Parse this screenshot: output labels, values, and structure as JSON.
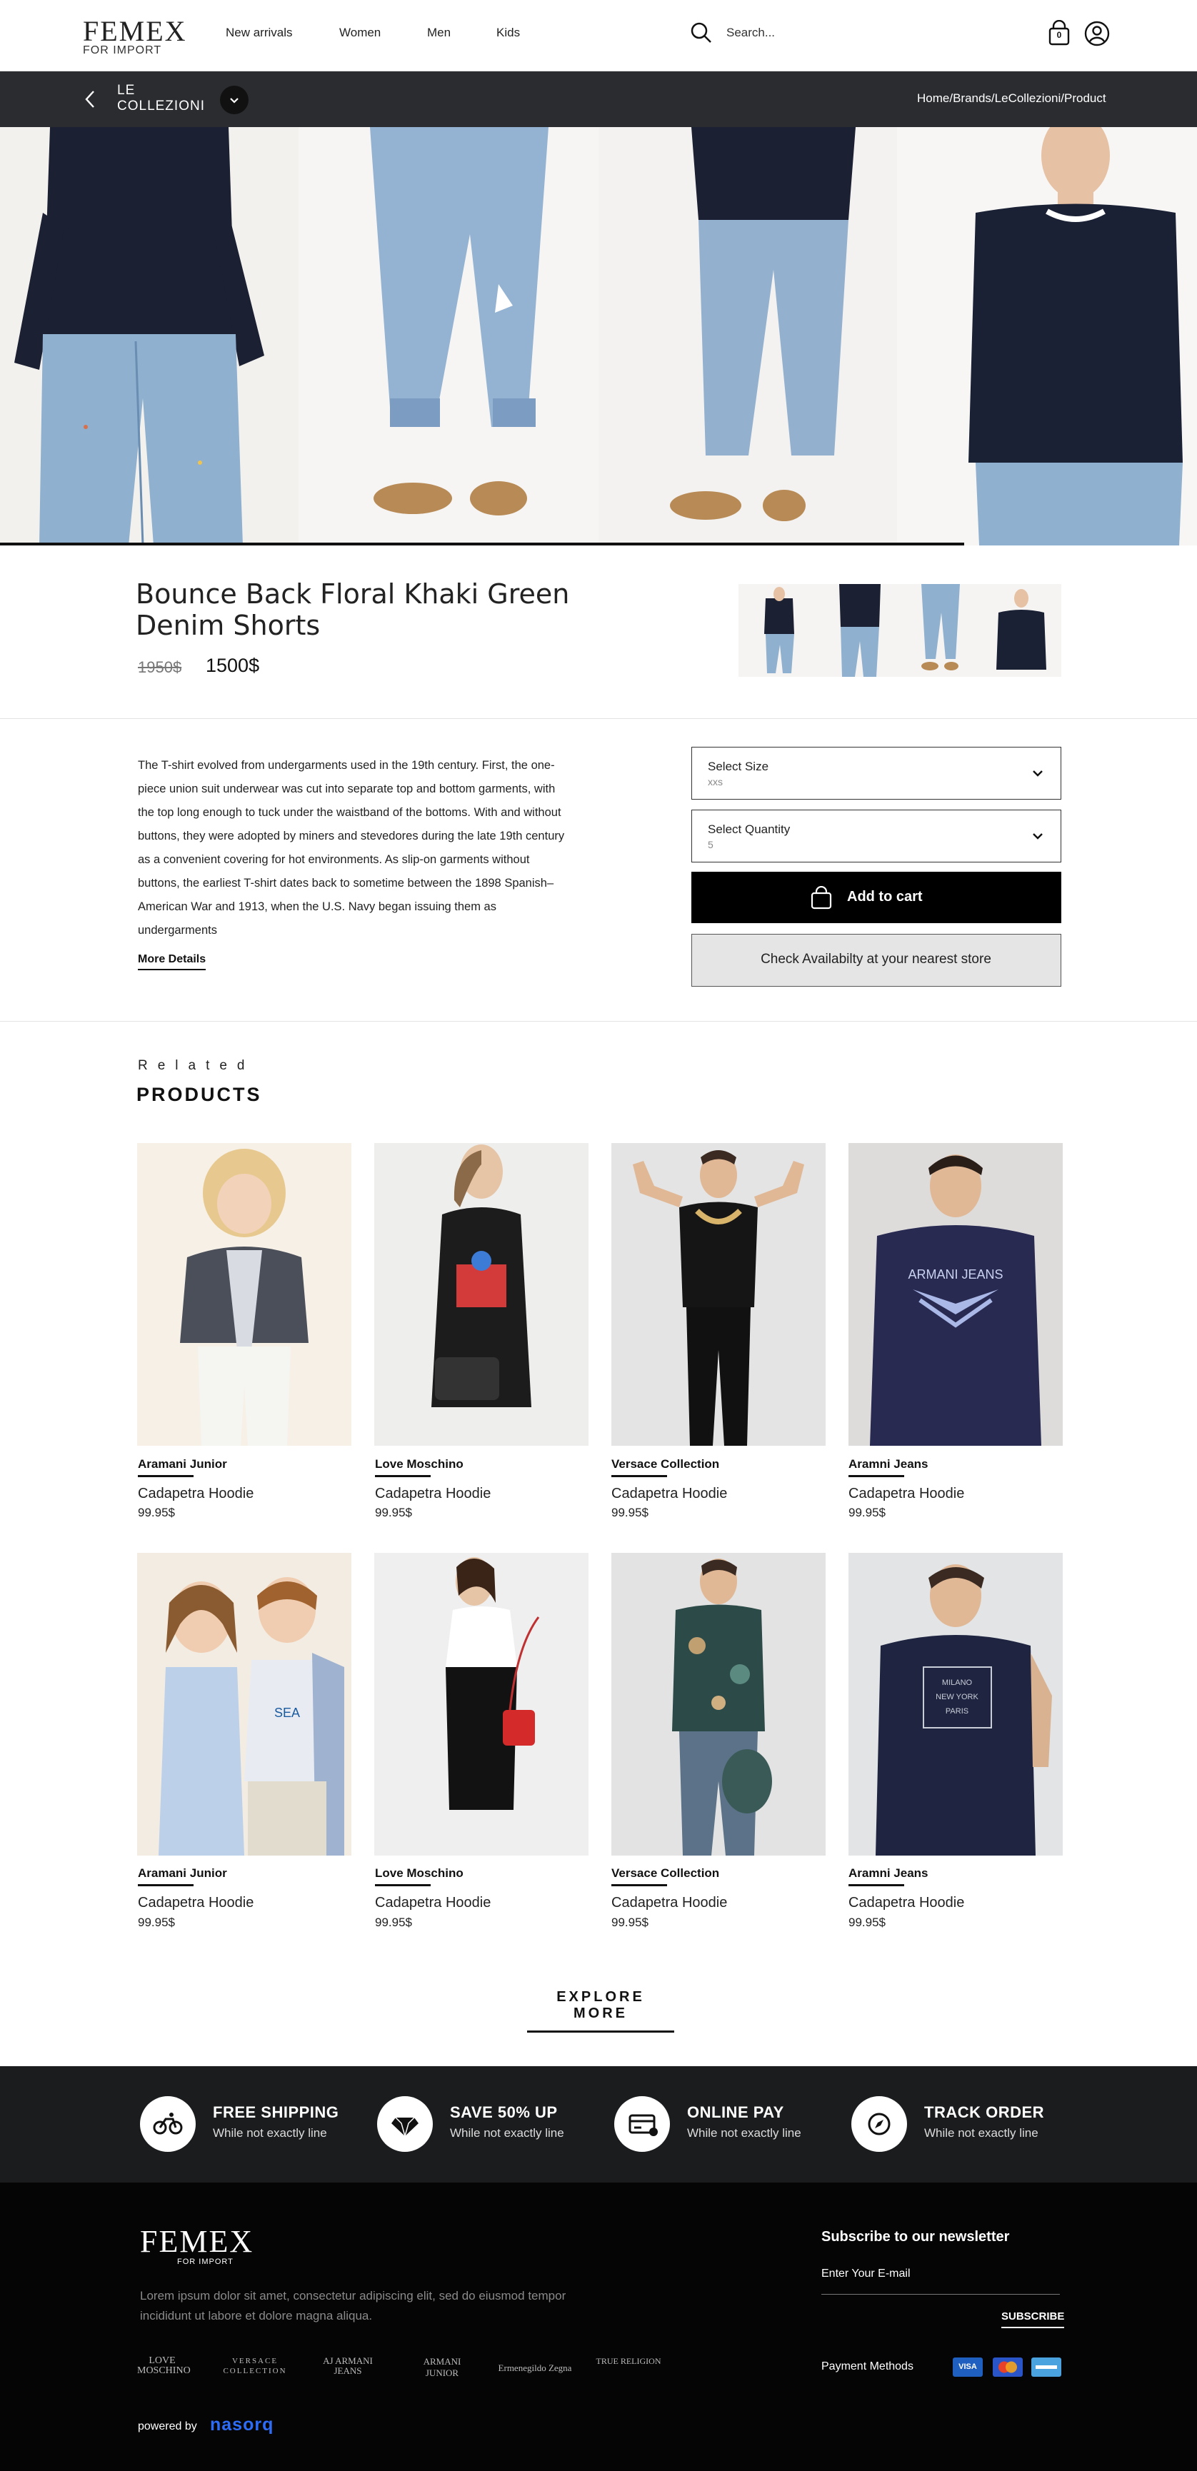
{
  "header": {
    "logo_main": "FEMEX",
    "logo_sub": "FOR IMPORT",
    "nav": [
      "New arrivals",
      "Women",
      "Men",
      "Kids"
    ],
    "search_placeholder": "Search...",
    "cart_count": "0"
  },
  "brandbar": {
    "brand_line1": "LE",
    "brand_line2": "COLLEZIONI",
    "breadcrumb": "Home/Brands/LeCollezioni/Product"
  },
  "product": {
    "title_line1": "Bounce Back Floral Khaki Green",
    "title_line2": "Denim Shorts",
    "old_price": "1950$",
    "price": "1500$",
    "description": "The T-shirt evolved from undergarments used in the 19th century. First, the one-piece union suit underwear was cut into separate top and bottom garments, with the top long enough to tuck under the waistband of the bottoms. With and without buttons, they were adopted by miners and stevedores during the late 19th century as a convenient covering for hot environments. As slip-on garments without buttons, the earliest T-shirt dates back to sometime between the 1898 Spanish–American War and 1913, when the U.S. Navy began issuing them as undergarments",
    "more_details": "More Details",
    "size_label": "Select Size",
    "size_value": "xxs",
    "qty_label": "Select Quantity",
    "qty_value": "5",
    "add_to_cart": "Add to cart",
    "check_availability": "Check Availabilty at your nearest store"
  },
  "related": {
    "kicker": "Related",
    "heading": "PRODUCTS",
    "items": [
      {
        "brand": "Aramani Junior",
        "name": "Cadapetra Hoodie",
        "price": "99.95$"
      },
      {
        "brand": "Love Moschino",
        "name": "Cadapetra Hoodie",
        "price": "99.95$"
      },
      {
        "brand": "Versace Collection",
        "name": "Cadapetra Hoodie",
        "price": "99.95$"
      },
      {
        "brand": "Aramni Jeans",
        "name": "Cadapetra Hoodie",
        "price": "99.95$"
      },
      {
        "brand": "Aramani Junior",
        "name": "Cadapetra Hoodie",
        "price": "99.95$"
      },
      {
        "brand": "Love Moschino",
        "name": "Cadapetra Hoodie",
        "price": "99.95$"
      },
      {
        "brand": "Versace Collection",
        "name": "Cadapetra Hoodie",
        "price": "99.95$"
      },
      {
        "brand": "Aramni Jeans",
        "name": "Cadapetra Hoodie",
        "price": "99.95$"
      }
    ],
    "explore": "EXPLORE MORE"
  },
  "features": [
    {
      "title": "FREE SHIPPING",
      "sub": "While not exactly line",
      "icon": "bike-icon"
    },
    {
      "title": "SAVE 50% UP",
      "sub": "While not exactly line",
      "icon": "diamond-icon"
    },
    {
      "title": "ONLINE PAY",
      "sub": "While not exactly line",
      "icon": "card-icon"
    },
    {
      "title": "TRACK ORDER",
      "sub": "While not exactly line",
      "icon": "compass-icon"
    }
  ],
  "footer": {
    "logo_main": "FEMEX",
    "logo_sub": "FOR IMPORT",
    "lorem": "Lorem ipsum dolor sit amet, consectetur adipiscing elit, sed do eiusmod tempor incididunt ut labore et dolore magna aliqua.",
    "brands": [
      "LOVE MOSCHINO",
      "VERSACE COLLECTION",
      "AJ ARMANI JEANS",
      "ARMANI JUNIOR",
      "Ermenegildo Zegna",
      "TRUE RELIGION"
    ],
    "newsletter_title": "Subscribe to our newsletter",
    "email_placeholder": "Enter Your E-mail",
    "subscribe": "SUBSCRIBE",
    "payment_label": "Payment Methods",
    "powered_by": "powered by",
    "powered_brand": "nasorq"
  },
  "colors": {
    "brandbar_bg": "#2a2c30",
    "features_bg": "#1b1c1e",
    "footer_bg": "#050505",
    "accent_blue": "#2d6cf6"
  }
}
